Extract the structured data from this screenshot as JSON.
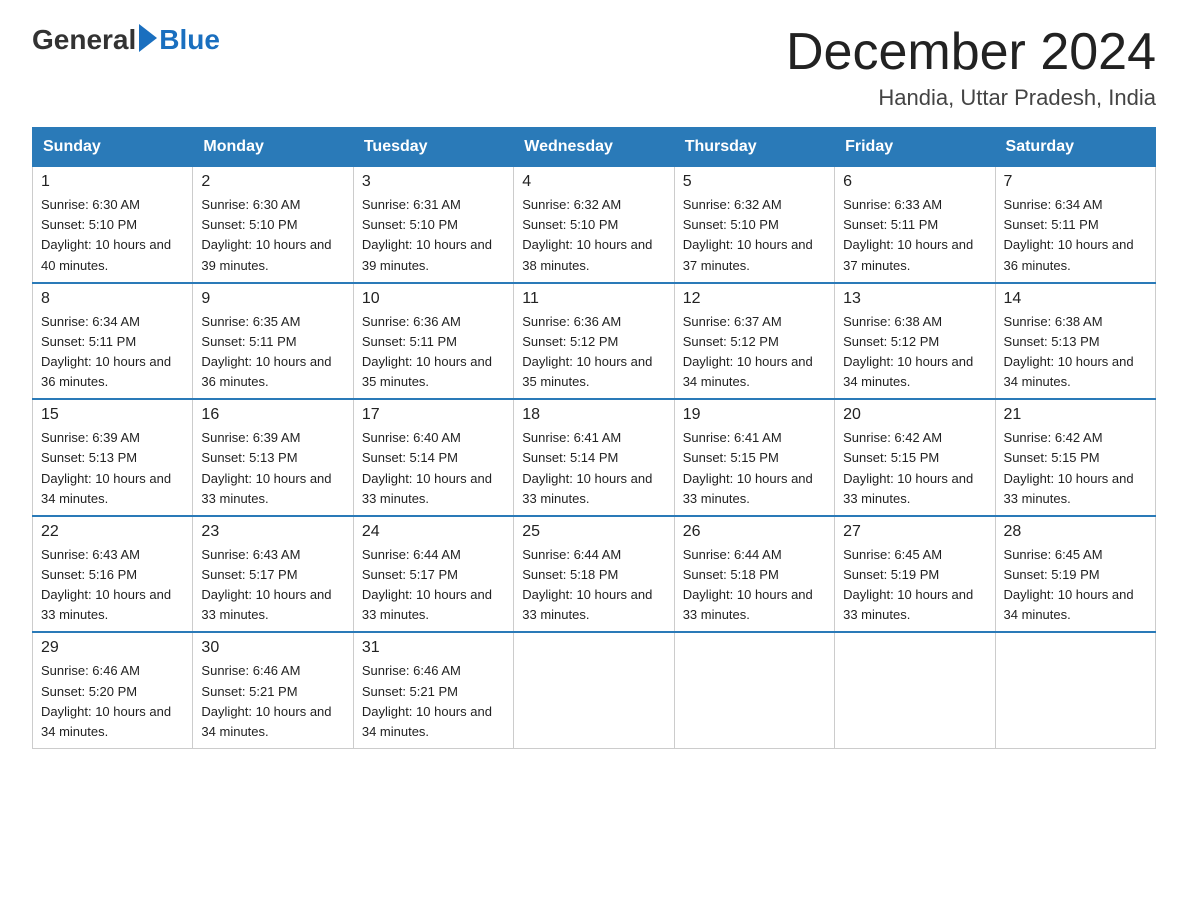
{
  "logo": {
    "general": "General",
    "blue": "Blue"
  },
  "title": "December 2024",
  "location": "Handia, Uttar Pradesh, India",
  "weekdays": [
    "Sunday",
    "Monday",
    "Tuesday",
    "Wednesday",
    "Thursday",
    "Friday",
    "Saturday"
  ],
  "weeks": [
    [
      {
        "day": "1",
        "sunrise": "6:30 AM",
        "sunset": "5:10 PM",
        "daylight": "10 hours and 40 minutes."
      },
      {
        "day": "2",
        "sunrise": "6:30 AM",
        "sunset": "5:10 PM",
        "daylight": "10 hours and 39 minutes."
      },
      {
        "day": "3",
        "sunrise": "6:31 AM",
        "sunset": "5:10 PM",
        "daylight": "10 hours and 39 minutes."
      },
      {
        "day": "4",
        "sunrise": "6:32 AM",
        "sunset": "5:10 PM",
        "daylight": "10 hours and 38 minutes."
      },
      {
        "day": "5",
        "sunrise": "6:32 AM",
        "sunset": "5:10 PM",
        "daylight": "10 hours and 37 minutes."
      },
      {
        "day": "6",
        "sunrise": "6:33 AM",
        "sunset": "5:11 PM",
        "daylight": "10 hours and 37 minutes."
      },
      {
        "day": "7",
        "sunrise": "6:34 AM",
        "sunset": "5:11 PM",
        "daylight": "10 hours and 36 minutes."
      }
    ],
    [
      {
        "day": "8",
        "sunrise": "6:34 AM",
        "sunset": "5:11 PM",
        "daylight": "10 hours and 36 minutes."
      },
      {
        "day": "9",
        "sunrise": "6:35 AM",
        "sunset": "5:11 PM",
        "daylight": "10 hours and 36 minutes."
      },
      {
        "day": "10",
        "sunrise": "6:36 AM",
        "sunset": "5:11 PM",
        "daylight": "10 hours and 35 minutes."
      },
      {
        "day": "11",
        "sunrise": "6:36 AM",
        "sunset": "5:12 PM",
        "daylight": "10 hours and 35 minutes."
      },
      {
        "day": "12",
        "sunrise": "6:37 AM",
        "sunset": "5:12 PM",
        "daylight": "10 hours and 34 minutes."
      },
      {
        "day": "13",
        "sunrise": "6:38 AM",
        "sunset": "5:12 PM",
        "daylight": "10 hours and 34 minutes."
      },
      {
        "day": "14",
        "sunrise": "6:38 AM",
        "sunset": "5:13 PM",
        "daylight": "10 hours and 34 minutes."
      }
    ],
    [
      {
        "day": "15",
        "sunrise": "6:39 AM",
        "sunset": "5:13 PM",
        "daylight": "10 hours and 34 minutes."
      },
      {
        "day": "16",
        "sunrise": "6:39 AM",
        "sunset": "5:13 PM",
        "daylight": "10 hours and 33 minutes."
      },
      {
        "day": "17",
        "sunrise": "6:40 AM",
        "sunset": "5:14 PM",
        "daylight": "10 hours and 33 minutes."
      },
      {
        "day": "18",
        "sunrise": "6:41 AM",
        "sunset": "5:14 PM",
        "daylight": "10 hours and 33 minutes."
      },
      {
        "day": "19",
        "sunrise": "6:41 AM",
        "sunset": "5:15 PM",
        "daylight": "10 hours and 33 minutes."
      },
      {
        "day": "20",
        "sunrise": "6:42 AM",
        "sunset": "5:15 PM",
        "daylight": "10 hours and 33 minutes."
      },
      {
        "day": "21",
        "sunrise": "6:42 AM",
        "sunset": "5:15 PM",
        "daylight": "10 hours and 33 minutes."
      }
    ],
    [
      {
        "day": "22",
        "sunrise": "6:43 AM",
        "sunset": "5:16 PM",
        "daylight": "10 hours and 33 minutes."
      },
      {
        "day": "23",
        "sunrise": "6:43 AM",
        "sunset": "5:17 PM",
        "daylight": "10 hours and 33 minutes."
      },
      {
        "day": "24",
        "sunrise": "6:44 AM",
        "sunset": "5:17 PM",
        "daylight": "10 hours and 33 minutes."
      },
      {
        "day": "25",
        "sunrise": "6:44 AM",
        "sunset": "5:18 PM",
        "daylight": "10 hours and 33 minutes."
      },
      {
        "day": "26",
        "sunrise": "6:44 AM",
        "sunset": "5:18 PM",
        "daylight": "10 hours and 33 minutes."
      },
      {
        "day": "27",
        "sunrise": "6:45 AM",
        "sunset": "5:19 PM",
        "daylight": "10 hours and 33 minutes."
      },
      {
        "day": "28",
        "sunrise": "6:45 AM",
        "sunset": "5:19 PM",
        "daylight": "10 hours and 34 minutes."
      }
    ],
    [
      {
        "day": "29",
        "sunrise": "6:46 AM",
        "sunset": "5:20 PM",
        "daylight": "10 hours and 34 minutes."
      },
      {
        "day": "30",
        "sunrise": "6:46 AM",
        "sunset": "5:21 PM",
        "daylight": "10 hours and 34 minutes."
      },
      {
        "day": "31",
        "sunrise": "6:46 AM",
        "sunset": "5:21 PM",
        "daylight": "10 hours and 34 minutes."
      },
      null,
      null,
      null,
      null
    ]
  ],
  "labels": {
    "sunrise_prefix": "Sunrise: ",
    "sunset_prefix": "Sunset: ",
    "daylight_prefix": "Daylight: "
  }
}
